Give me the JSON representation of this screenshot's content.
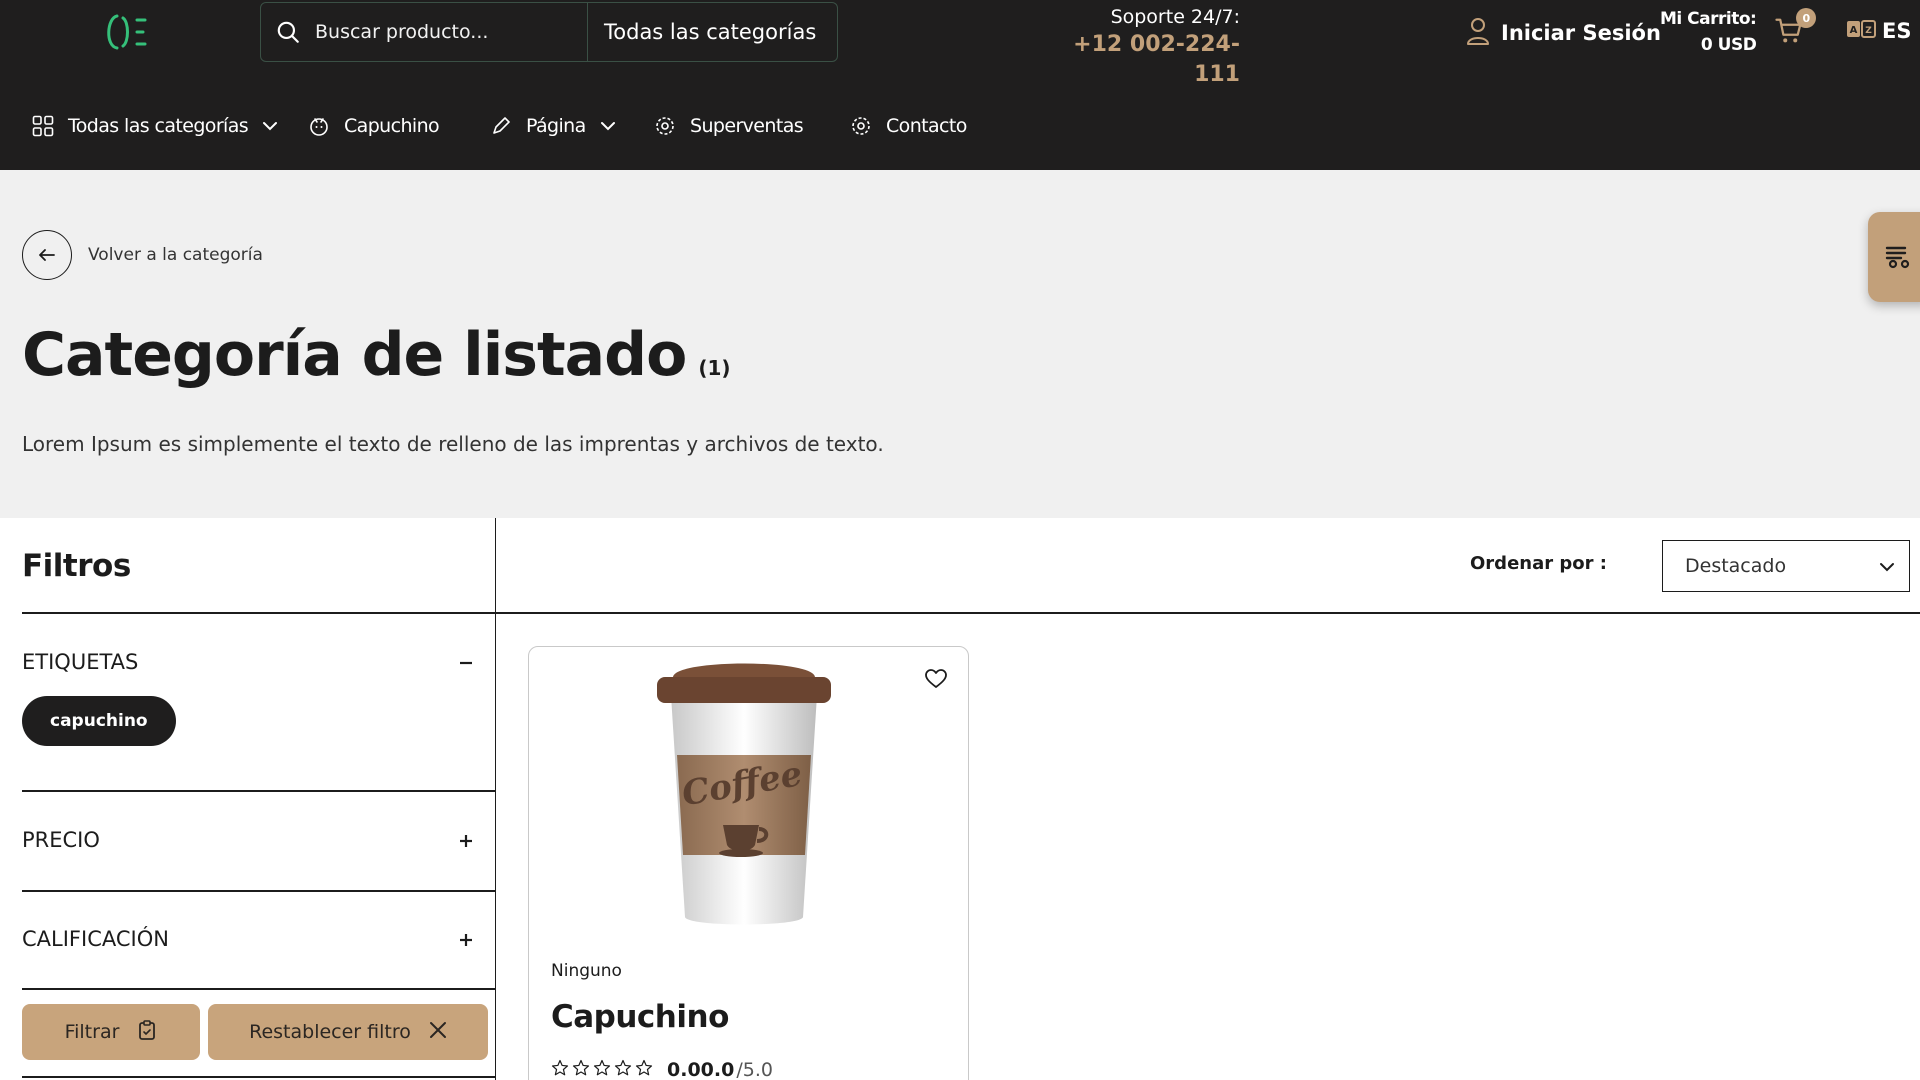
{
  "header": {
    "logo_icon": "logo-icon",
    "search": {
      "placeholder": "Buscar producto...",
      "category": "Todas las categorías"
    },
    "support": {
      "label": "Soporte 24/7:",
      "phone": "+12 002-224-111"
    },
    "login": "Iniciar Sesión",
    "cart": {
      "label": "Mi Carrito:",
      "total": "0 USD",
      "count": "0"
    },
    "lang": "ES"
  },
  "nav": {
    "items": [
      {
        "label": "Todas las categorías",
        "icon": "grid-icon"
      },
      {
        "label": "Capuchino",
        "icon": "coffee-icon"
      },
      {
        "label": "Página",
        "icon": "pen-icon"
      },
      {
        "label": "Superventas",
        "icon": "gear-icon"
      },
      {
        "label": "Contacto",
        "icon": "gear-icon"
      }
    ]
  },
  "hero": {
    "back": "Volver a la categoría",
    "title": "Categoría de listado",
    "count": "(1)",
    "description": "Lorem Ipsum es simplemente el texto de relleno de las imprentas y archivos de texto."
  },
  "filters": {
    "title": "Filtros",
    "sections": [
      {
        "title": "ETIQUETAS",
        "state": "expanded"
      },
      {
        "title": "PRECIO",
        "state": "collapsed"
      },
      {
        "title": "CALIFICACIÓN",
        "state": "collapsed"
      }
    ],
    "tags": [
      "capuchino"
    ],
    "filter_button": "Filtrar",
    "reset_button": "Restablecer filtro"
  },
  "sort": {
    "label": "Ordenar por :",
    "value": "Destacado"
  },
  "products": [
    {
      "brand": "Ninguno",
      "name": "Capuchino",
      "rating": "0.00.0",
      "rating_max": "/5.0",
      "cup_text": "Coffee"
    }
  ],
  "colors": {
    "accent": "#c2a07a",
    "header_bg": "#1f1e1e",
    "hero_bg": "#f0f0f0",
    "logo": "#35c07a"
  }
}
